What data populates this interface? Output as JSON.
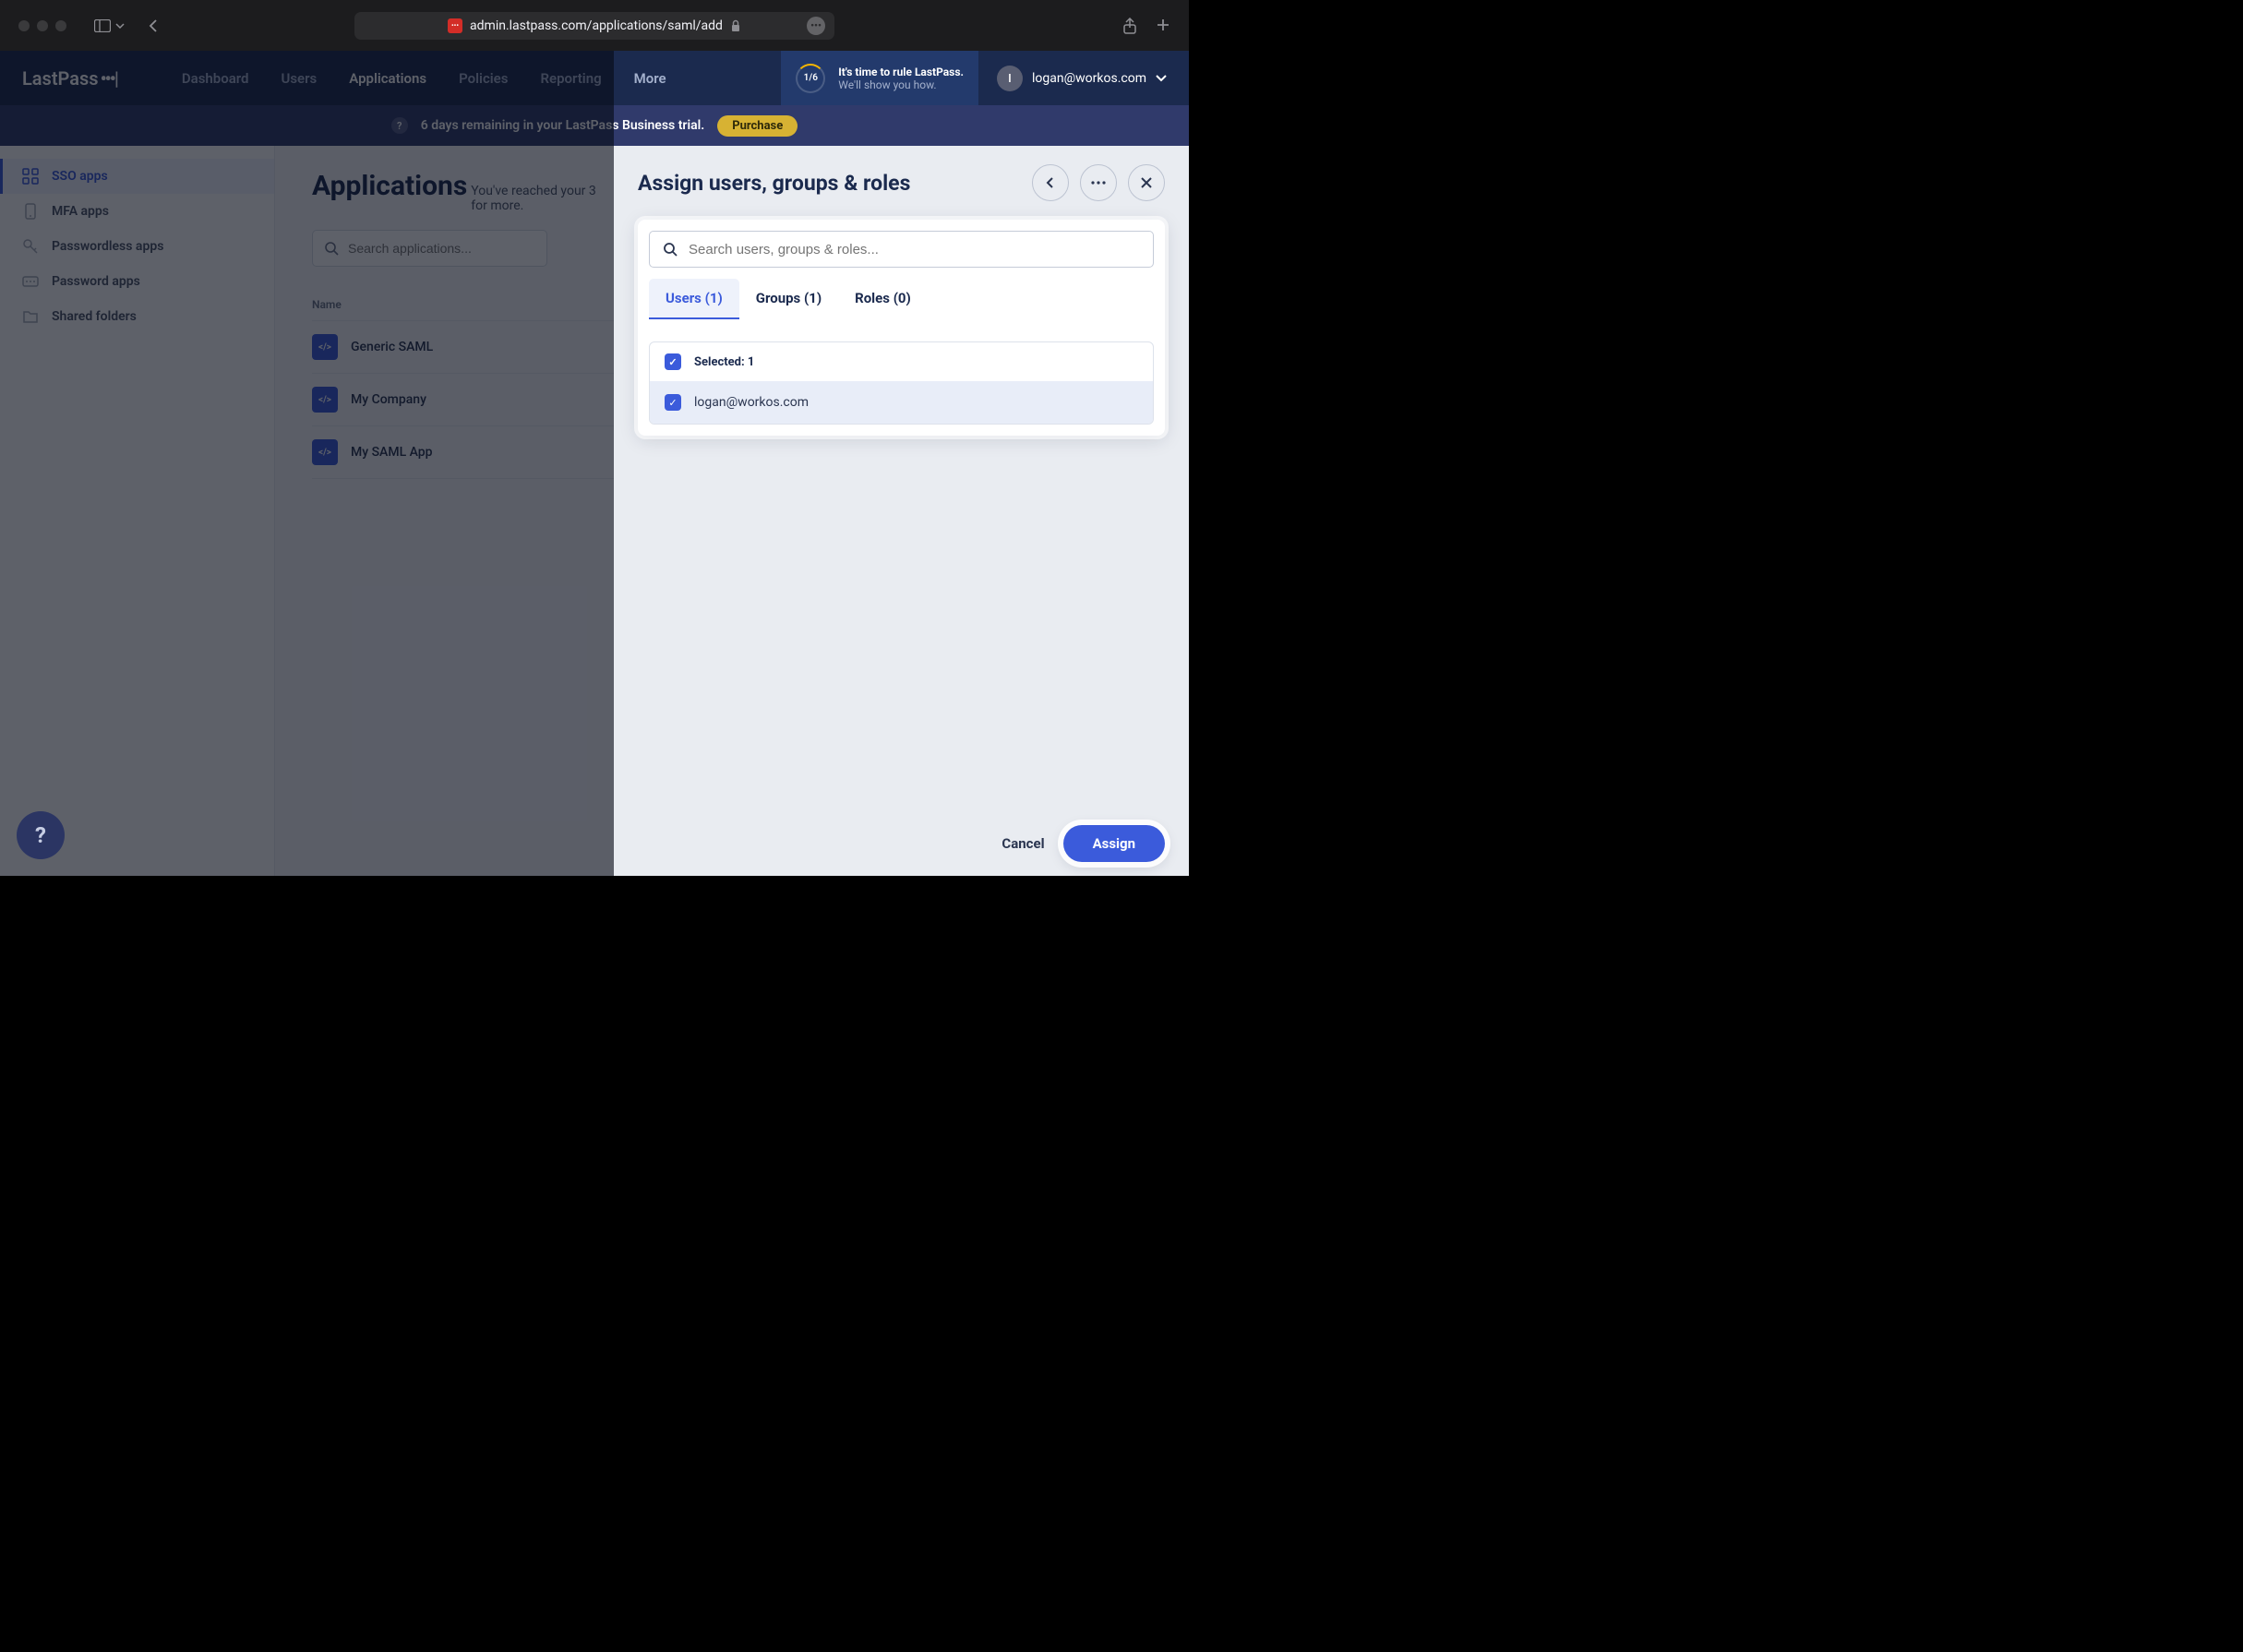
{
  "browser": {
    "url": "admin.lastpass.com/applications/saml/add"
  },
  "logo": "LastPass",
  "nav": {
    "dashboard": "Dashboard",
    "users": "Users",
    "applications": "Applications",
    "policies": "Policies",
    "reporting": "Reporting",
    "more": "More"
  },
  "promo": {
    "progress": "1/6",
    "line1": "It's time to rule LastPass.",
    "line2": "We'll show you how."
  },
  "account": {
    "initial": "l",
    "email": "logan@workos.com"
  },
  "banner": {
    "text": "6 days remaining in your LastPass Business trial.",
    "cta": "Purchase"
  },
  "sidebar": {
    "sso": "SSO apps",
    "mfa": "MFA apps",
    "passwordless": "Passwordless apps",
    "password": "Password apps",
    "shared": "Shared folders"
  },
  "page": {
    "title": "Applications",
    "subtitle_line1": "You've reached your 3",
    "subtitle_line2": "for more.",
    "search_placeholder": "Search applications...",
    "name_col": "Name",
    "apps": [
      "Generic SAML",
      "My Company",
      "My SAML App"
    ]
  },
  "drawer": {
    "title": "Assign users, groups & roles",
    "search_placeholder": "Search users, groups & roles...",
    "tabs": {
      "users": "Users (1)",
      "groups": "Groups (1)",
      "roles": "Roles (0)"
    },
    "selected_label": "Selected: 1",
    "user_email": "logan@workos.com",
    "cancel": "Cancel",
    "assign": "Assign"
  }
}
